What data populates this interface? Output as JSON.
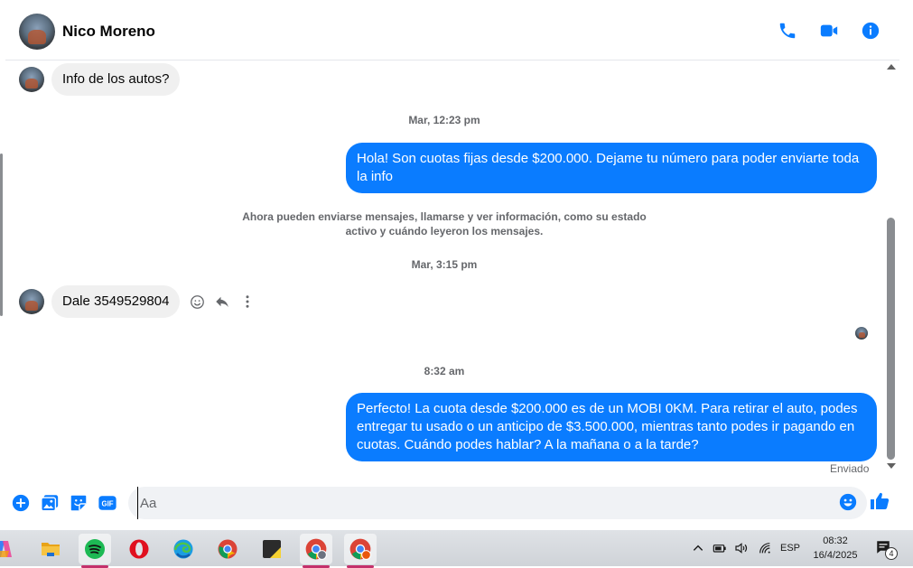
{
  "contact": {
    "name": "Nico Moreno"
  },
  "colors": {
    "accent": "#0a7cff",
    "incoming_bg": "#f0f0f0",
    "meta_text": "#65676b"
  },
  "messages": [
    {
      "type": "incoming",
      "text": "Info de los autos?"
    },
    {
      "type": "timestamp",
      "text": "Mar, 12:23 pm"
    },
    {
      "type": "outgoing",
      "text": "Hola! Son cuotas fijas desde $200.000. Dejame tu número para poder enviarte toda la info"
    },
    {
      "type": "system",
      "line1": "Ahora pueden enviarse mensajes, llamarse y ver información, como su estado",
      "line2": "activo y cuándo leyeron los mensajes."
    },
    {
      "type": "timestamp",
      "text": "Mar, 3:15 pm"
    },
    {
      "type": "incoming",
      "text": "Dale 3549529804"
    },
    {
      "type": "timestamp",
      "text": "8:32 am"
    },
    {
      "type": "outgoing",
      "text": "Perfecto! La cuota desde $200.000 es de un MOBI 0KM. Para retirar el auto, podes entregar tu usado o un anticipo de $3.500.000, mientras tanto podes ir pagando en cuotas. Cuándo podes hablar? A la mañana o a la tarde?"
    }
  ],
  "status": "Enviado",
  "composer": {
    "placeholder": "Aa",
    "gif_label": "GIF"
  },
  "icons": {
    "header": [
      "phone-icon",
      "video-camera-icon",
      "info-icon"
    ],
    "message_actions": [
      "smiley-icon",
      "reply-icon",
      "more-options-icon"
    ],
    "composer": [
      "plus-icon",
      "image-icon",
      "sticker-icon",
      "gif-icon",
      "emoji-icon",
      "thumbs-up-icon"
    ]
  },
  "taskbar": {
    "apps": [
      "copilot-icon",
      "file-explorer-icon",
      "spotify-icon",
      "opera-icon",
      "edge-icon",
      "chrome-icon",
      "sticky-notes-icon",
      "chrome-profile-1-icon",
      "chrome-profile-2-icon"
    ],
    "language": "ESP",
    "time": "08:32",
    "date": "16/4/2025",
    "notifications": "4"
  }
}
